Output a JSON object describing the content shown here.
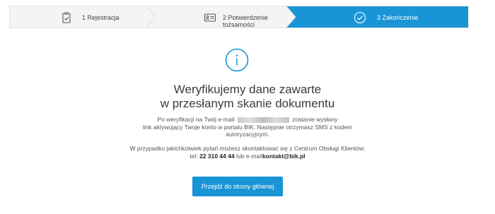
{
  "stepper": {
    "steps": [
      {
        "label": "1 Rejestracja",
        "icon": "clipboard-check-icon",
        "state": "done"
      },
      {
        "label": "2 Potwierdzenie tożsamości",
        "icon": "id-card-icon",
        "state": "done"
      },
      {
        "label": "3 Zakończenie",
        "icon": "check-circle-icon",
        "state": "active"
      }
    ],
    "active_color": "#1995d6"
  },
  "main": {
    "icon": "info-icon",
    "title_line1": "Weryfikujemy dane zawarte",
    "title_line2": "w przesłanym skanie dokumentu",
    "verify_text": {
      "line1_prefix": "Po weryfikacji na Twój e-mail",
      "line1_suffix": "zostanie wysłany",
      "line2": "link aktywujący Twoje konto w portalu BIK. Następnie otrzymasz SMS z kodem",
      "line3": "autoryzacyjnym."
    },
    "contact_text": {
      "line1": "W przypadku jakichkolwiek pytań możesz skontaktować się z Centrum Obsługi Klientów:",
      "tel_prefix": "tel:",
      "tel": "22 310 44 44",
      "email_prefix": "lub e-mail",
      "email": "kontakt@bik.pl"
    },
    "cta_label": "Przejdź do strony głównej"
  }
}
